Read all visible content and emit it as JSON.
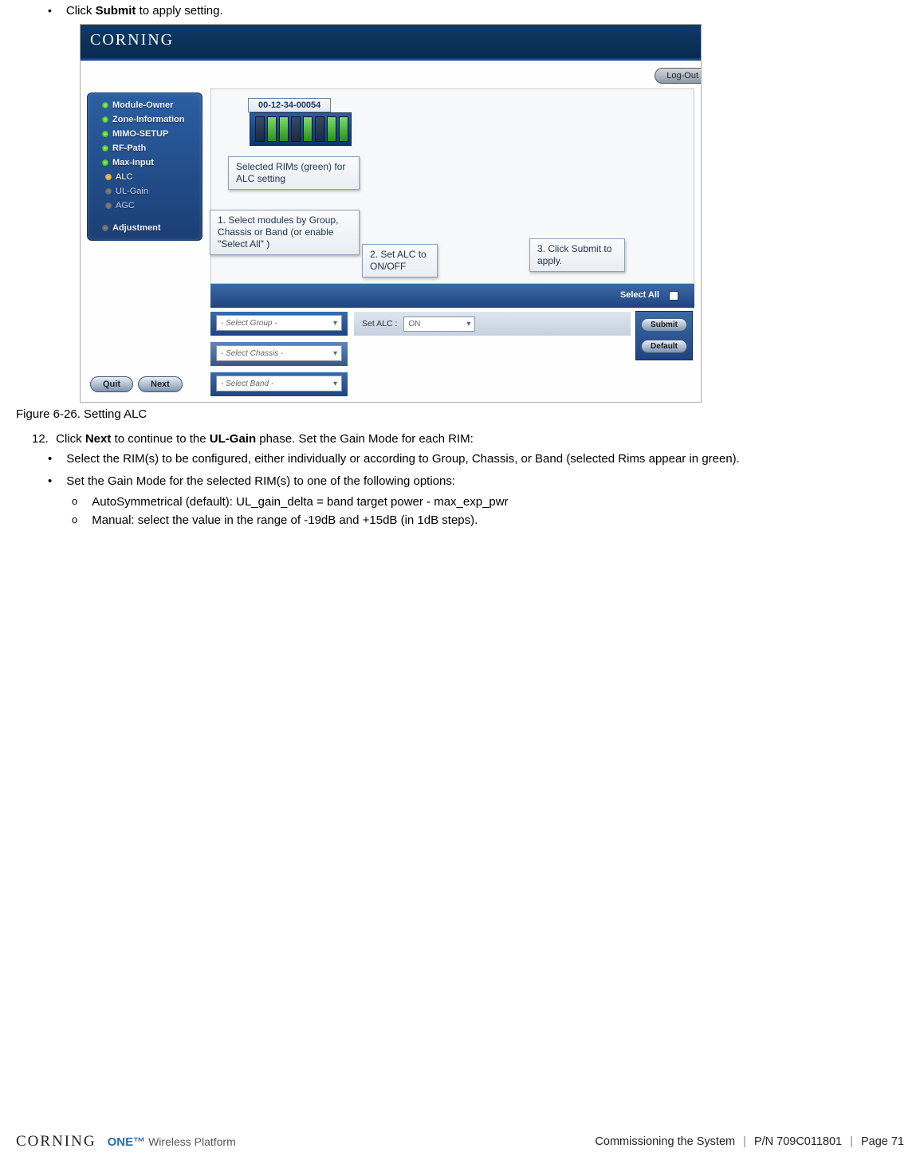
{
  "doc": {
    "top_bullet_prefix": "Click ",
    "top_bullet_bold": "Submit",
    "top_bullet_suffix": " to apply setting.",
    "caption": "Figure 6-26. Setting ALC",
    "step12_num": "12.",
    "step12_p1": "Click ",
    "step12_b1": "Next",
    "step12_p2": " to continue to the ",
    "step12_b2": "UL-Gain",
    "step12_p3": " phase. Set the Gain Mode for each RIM:",
    "b1": "Select the RIM(s) to be configured, either individually or according to Group, Chassis, or Band (selected Rims appear in green).",
    "b2": "Set the Gain Mode for the selected RIM(s) to one of the following options:",
    "o1": "AutoSymmetrical (default): UL_gain_delta = band target power - max_exp_pwr",
    "o2": "Manual: select the value in the range of -19dB and +15dB (in 1dB steps)."
  },
  "shot": {
    "brand": "CORNING",
    "logout": "Log-Out",
    "sidebar": {
      "i0": "Module-Owner",
      "i1": "Zone-Information",
      "i2": "MIMO-SETUP",
      "i3": "RF-Path",
      "i4": "Max-Input",
      "s0": "ALC",
      "s1": "UL-Gain",
      "s2": "AGC",
      "adj": "Adjustment"
    },
    "btn_quit": "Quit",
    "btn_next": "Next",
    "mac": "00-12-34-00054",
    "callout_sel": "Selected RIMs (green) for ALC setting",
    "callout1": "1. Select modules by Group, Chassis or Band (or enable \"Select All\" )",
    "callout2": "2. Set ALC to ON/OFF",
    "callout3": "3. Click Submit to apply.",
    "select_all": "Select All",
    "btn_submit": "Submit",
    "btn_default": "Default",
    "dd_group": "- Select Group -",
    "dd_chassis": "- Select Chassis -",
    "dd_band": "- Select Band -",
    "set_alc_label": "Set ALC :",
    "set_alc_val": "ON"
  },
  "footer": {
    "brand": "CORNING",
    "one": "ONE™",
    "one_sub": "Wireless Platform",
    "section": "Commissioning the System",
    "pn": "P/N 709C011801",
    "page": "Page 71"
  }
}
